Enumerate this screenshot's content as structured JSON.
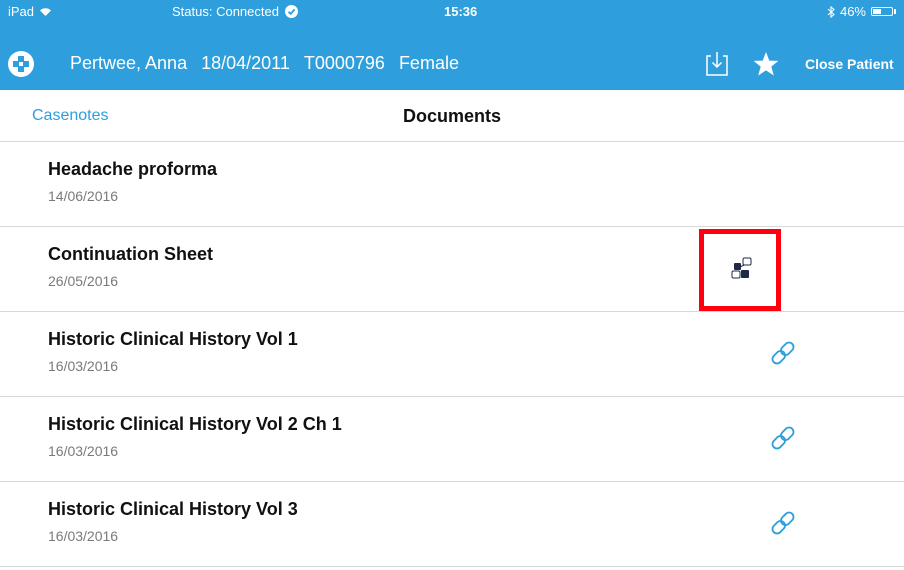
{
  "status_bar": {
    "device": "iPad",
    "connection": "Status: Connected",
    "time": "15:36",
    "battery": "46%",
    "battery_level": 0.46
  },
  "patient_bar": {
    "name": "Pertwee, Anna",
    "dob": "18/04/2011",
    "id": "T0000796",
    "gender": "Female",
    "close_label": "Close Patient"
  },
  "nav": {
    "back_label": "Casenotes",
    "title": "Documents"
  },
  "documents": [
    {
      "title": "Headache proforma",
      "date": "14/06/2016",
      "icon": "none"
    },
    {
      "title": "Continuation Sheet",
      "date": "26/05/2016",
      "icon": "structured-form-icon"
    },
    {
      "title": "Historic Clinical History Vol 1",
      "date": "16/03/2016",
      "icon": "link-icon"
    },
    {
      "title": "Historic Clinical History Vol 2 Ch 1",
      "date": "16/03/2016",
      "icon": "link-icon"
    },
    {
      "title": "Historic Clinical History Vol 3",
      "date": "16/03/2016",
      "icon": "link-icon"
    }
  ],
  "colors": {
    "header_blue": "#2e9fdc",
    "highlight_red": "#ff0010",
    "link_blue": "#2e9fdc"
  }
}
